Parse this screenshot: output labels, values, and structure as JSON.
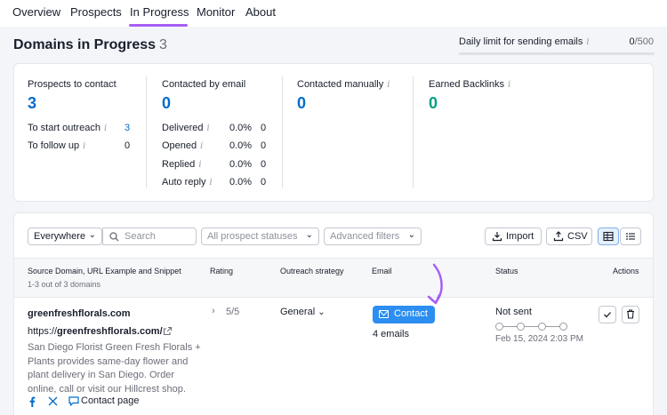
{
  "nav": {
    "tabs": [
      "Overview",
      "Prospects",
      "In Progress",
      "Monitor",
      "About"
    ],
    "active": "In Progress"
  },
  "header": {
    "title": "Domains in Progress",
    "count": "3",
    "limit_label": "Daily limit for sending emails",
    "limit_used": "0",
    "limit_total": "/500"
  },
  "stats": {
    "prospects": {
      "title": "Prospects to contact",
      "value": "3",
      "rows": [
        {
          "label": "To start outreach",
          "value": "3"
        },
        {
          "label": "To follow up",
          "value": "0"
        }
      ]
    },
    "email": {
      "title": "Contacted by email",
      "value": "0",
      "rows": [
        {
          "label": "Delivered",
          "pct": "0.0%",
          "value": "0"
        },
        {
          "label": "Opened",
          "pct": "0.0%",
          "value": "0"
        },
        {
          "label": "Replied",
          "pct": "0.0%",
          "value": "0"
        },
        {
          "label": "Auto reply",
          "pct": "0.0%",
          "value": "0"
        }
      ]
    },
    "manual": {
      "title": "Contacted manually",
      "value": "0"
    },
    "backlinks": {
      "title": "Earned Backlinks",
      "value": "0"
    }
  },
  "filters": {
    "scope": "Everywhere",
    "search_placeholder": "Search",
    "statuses": "All prospect statuses",
    "advanced": "Advanced filters",
    "import": "Import",
    "csv": "CSV"
  },
  "table": {
    "headers": {
      "source": "Source Domain, URL Example and Snippet",
      "source_sub": "1-3 out of 3 domains",
      "rating": "Rating",
      "strategy": "Outreach strategy",
      "email": "Email",
      "status": "Status",
      "actions": "Actions"
    },
    "rows": [
      {
        "domain": "greenfreshflorals.com",
        "url_prefix": "https://",
        "url_domain": "greenfreshflorals.com/",
        "snippet": "San Diego Florist Green Fresh Florals + Plants provides same-day flower and plant delivery in San Diego. Order online, call or visit our Hillcrest shop.",
        "contact_page": "Contact page",
        "rating": "5/5",
        "strategy": "General",
        "contact_btn": "Contact",
        "emails": "4 emails",
        "status": "Not sent",
        "status_date": "Feb 15, 2024 2:03 PM"
      }
    ]
  },
  "colors": {
    "accent": "#a75ff5",
    "link": "#006dca",
    "backlinks": "#009f81",
    "contact_button": "#2b8ef0"
  },
  "icons": [
    "info-icon",
    "search-icon",
    "chevron-down-icon",
    "import-icon",
    "export-icon",
    "table-view-icon",
    "list-view-icon",
    "external-link-icon",
    "facebook-icon",
    "x-twitter-icon",
    "chat-icon",
    "mail-icon",
    "check-icon",
    "trash-icon",
    "arrow-annotation-icon"
  ]
}
